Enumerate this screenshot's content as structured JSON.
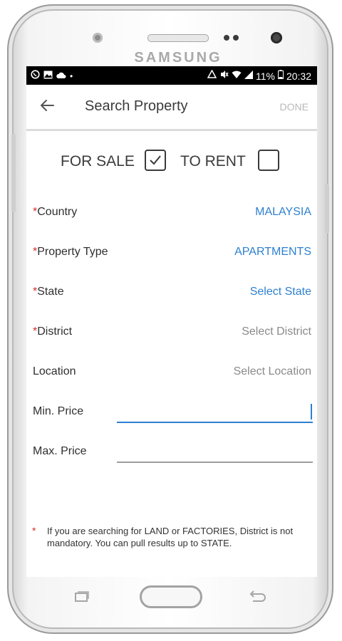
{
  "device": {
    "brand": "SAMSUNG"
  },
  "status_bar": {
    "left_icons": [
      "whatsapp-icon",
      "image-icon",
      "cloud-icon",
      "dot-icon"
    ],
    "right_icons": [
      "nfc-icon",
      "mute-icon",
      "wifi-icon",
      "signal-icon"
    ],
    "battery": "11%",
    "time": "20:32"
  },
  "app_bar": {
    "back_icon": "arrow-left-icon",
    "title": "Search Property",
    "done_label": "DONE"
  },
  "listing_mode": {
    "for_sale_label": "FOR SALE",
    "for_sale_checked": true,
    "to_rent_label": "TO RENT",
    "to_rent_checked": false
  },
  "fields": [
    {
      "required": true,
      "label": "Country",
      "value": "MALAYSIA"
    },
    {
      "required": true,
      "label": "Property Type",
      "value": "APARTMENTS"
    },
    {
      "required": true,
      "label": "State",
      "value": "Select State"
    },
    {
      "required": true,
      "label": "District",
      "value": "Select District"
    },
    {
      "required": false,
      "label": "Location",
      "value": "Select Location"
    }
  ],
  "required_marker": "*",
  "price": {
    "min_label": "Min. Price",
    "min_value": "",
    "max_label": "Max. Price",
    "max_value": ""
  },
  "note": {
    "marker": "*",
    "text": "If you are searching for LAND or FACTORIES, District is not mandatory. You can pull results up to STATE."
  },
  "colors": {
    "accent": "#2f80d0",
    "required": "#d32f2f",
    "placeholder": "#8a8a8a"
  }
}
